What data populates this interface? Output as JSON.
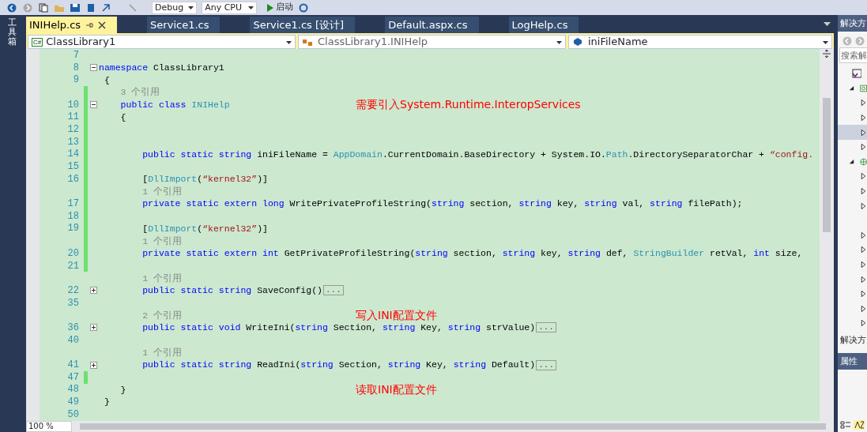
{
  "toolbar": {
    "config": "Debug",
    "platform": "Any CPU",
    "start": "启动"
  },
  "toolbox_label": "工具箱",
  "tabs": [
    {
      "label": "INIHelp.cs",
      "selected": true
    },
    {
      "label": "Service1.cs",
      "selected": false
    },
    {
      "label": "Service1.cs [设计]",
      "selected": false
    },
    {
      "label": "Default.aspx.cs",
      "selected": false
    },
    {
      "label": "LogHelp.cs",
      "selected": false
    }
  ],
  "nav": {
    "project_icon": "C#",
    "project": "ClassLibrary1",
    "type": "ClassLibrary1.INIHelp",
    "member": "iniFileName"
  },
  "lines": [
    {
      "kind": "code",
      "number": "7"
    },
    {
      "kind": "code",
      "number": "8",
      "folded": false,
      "tokens": [
        {
          "t": "namespace",
          "kind": "kw"
        },
        {
          "t": " ClassLibrary1",
          "kind": "plain"
        }
      ]
    },
    {
      "kind": "code",
      "number": "9",
      "tokens": [
        {
          "t": " {",
          "kind": "plain"
        }
      ]
    },
    {
      "kind": "lens",
      "changed": true,
      "text": "    3 个引用"
    },
    {
      "kind": "code",
      "number": "10",
      "changed": true,
      "folded": false,
      "note": "需要引入System.Runtime.InteropServices",
      "tokens": [
        {
          "t": "    public class",
          "kind": "kw"
        },
        {
          "t": " INIHelp",
          "kind": "type"
        }
      ]
    },
    {
      "kind": "code",
      "number": "11",
      "changed": true,
      "tokens": [
        {
          "t": "    {",
          "kind": "plain"
        }
      ]
    },
    {
      "kind": "code",
      "number": "12",
      "changed": true
    },
    {
      "kind": "code",
      "number": "13",
      "changed": true
    },
    {
      "kind": "code",
      "number": "14",
      "changed": true,
      "tokens": [
        {
          "t": "        public static string",
          "kind": "kw"
        },
        {
          "t": " iniFileName = ",
          "kind": "plain"
        },
        {
          "t": "AppDomain",
          "kind": "type"
        },
        {
          "t": ".CurrentDomain.BaseDirectory + System.IO.",
          "kind": "plain"
        },
        {
          "t": "Path",
          "kind": "type"
        },
        {
          "t": ".DirectorySeparatorChar + ",
          "kind": "plain"
        },
        {
          "t": "“config.",
          "kind": "str"
        }
      ]
    },
    {
      "kind": "code",
      "number": "15",
      "changed": true
    },
    {
      "kind": "code",
      "number": "16",
      "changed": true,
      "tokens": [
        {
          "t": "        [",
          "kind": "plain"
        },
        {
          "t": "DllImport",
          "kind": "type"
        },
        {
          "t": "(",
          "kind": "plain"
        },
        {
          "t": "“kernel32”",
          "kind": "str"
        },
        {
          "t": ")]",
          "kind": "plain"
        }
      ]
    },
    {
      "kind": "lens",
      "changed": true,
      "text": "        1 个引用"
    },
    {
      "kind": "code",
      "number": "17",
      "changed": true,
      "tokens": [
        {
          "t": "        private static extern long",
          "kind": "kw"
        },
        {
          "t": " WritePrivateProfileString(",
          "kind": "plain"
        },
        {
          "t": "string",
          "kind": "kw"
        },
        {
          "t": " section, ",
          "kind": "plain"
        },
        {
          "t": "string",
          "kind": "kw"
        },
        {
          "t": " key, ",
          "kind": "plain"
        },
        {
          "t": "string",
          "kind": "kw"
        },
        {
          "t": " val, ",
          "kind": "plain"
        },
        {
          "t": "string",
          "kind": "kw"
        },
        {
          "t": " filePath);",
          "kind": "plain"
        }
      ]
    },
    {
      "kind": "code",
      "number": "18",
      "changed": true
    },
    {
      "kind": "code",
      "number": "19",
      "changed": true,
      "tokens": [
        {
          "t": "        [",
          "kind": "plain"
        },
        {
          "t": "DllImport",
          "kind": "type"
        },
        {
          "t": "(",
          "kind": "plain"
        },
        {
          "t": "“kernel32”",
          "kind": "str"
        },
        {
          "t": ")]",
          "kind": "plain"
        }
      ]
    },
    {
      "kind": "lens",
      "changed": true,
      "text": "        1 个引用"
    },
    {
      "kind": "code",
      "number": "20",
      "changed": true,
      "tokens": [
        {
          "t": "        private static extern int",
          "kind": "kw"
        },
        {
          "t": " GetPrivateProfileString(",
          "kind": "plain"
        },
        {
          "t": "string",
          "kind": "kw"
        },
        {
          "t": " section, ",
          "kind": "plain"
        },
        {
          "t": "string",
          "kind": "kw"
        },
        {
          "t": " key, ",
          "kind": "plain"
        },
        {
          "t": "string",
          "kind": "kw"
        },
        {
          "t": " def, ",
          "kind": "plain"
        },
        {
          "t": "StringBuilder",
          "kind": "type"
        },
        {
          "t": " retVal, ",
          "kind": "plain"
        },
        {
          "t": "int",
          "kind": "kw"
        },
        {
          "t": " size,",
          "kind": "plain"
        }
      ]
    },
    {
      "kind": "code",
      "number": "21",
      "changed": true
    },
    {
      "kind": "lens",
      "text": "        1 个引用"
    },
    {
      "kind": "code",
      "number": "22",
      "folded": true,
      "collapsed": "...",
      "tokens": [
        {
          "t": "        public static string",
          "kind": "kw"
        },
        {
          "t": " SaveConfig()",
          "kind": "plain"
        }
      ]
    },
    {
      "kind": "code",
      "number": "35"
    },
    {
      "kind": "lens",
      "text": "        2 个引用",
      "note": "写入INI配置文件"
    },
    {
      "kind": "code",
      "number": "36",
      "folded": true,
      "collapsed": "...",
      "tokens": [
        {
          "t": "        public static void",
          "kind": "kw"
        },
        {
          "t": " WriteIni(",
          "kind": "plain"
        },
        {
          "t": "string",
          "kind": "kw"
        },
        {
          "t": " Section, ",
          "kind": "plain"
        },
        {
          "t": "string",
          "kind": "kw"
        },
        {
          "t": " Key, ",
          "kind": "plain"
        },
        {
          "t": "string",
          "kind": "kw"
        },
        {
          "t": " strValue)",
          "kind": "plain"
        }
      ]
    },
    {
      "kind": "code",
      "number": "40"
    },
    {
      "kind": "lens",
      "text": "        1 个引用"
    },
    {
      "kind": "code",
      "number": "41",
      "folded": true,
      "collapsed": "...",
      "tokens": [
        {
          "t": "        public static string",
          "kind": "kw"
        },
        {
          "t": " ReadIni(",
          "kind": "plain"
        },
        {
          "t": "string",
          "kind": "kw"
        },
        {
          "t": " Section, ",
          "kind": "plain"
        },
        {
          "t": "string",
          "kind": "kw"
        },
        {
          "t": " Key, ",
          "kind": "plain"
        },
        {
          "t": "string",
          "kind": "kw"
        },
        {
          "t": " Default)",
          "kind": "plain"
        }
      ]
    },
    {
      "kind": "code",
      "number": "47",
      "changed": true
    },
    {
      "kind": "code",
      "number": "48",
      "note": "读取INI配置文件",
      "tokens": [
        {
          "t": "    }",
          "kind": "plain"
        }
      ]
    },
    {
      "kind": "code",
      "number": "49",
      "tokens": [
        {
          "t": " }",
          "kind": "plain"
        }
      ]
    },
    {
      "kind": "code",
      "number": "50"
    }
  ],
  "zoom": "100 %",
  "solution_explorer": {
    "title": "解决方",
    "search_placeholder": "搜索解",
    "tree": [
      {
        "kind": "solution",
        "selected": false
      },
      {
        "kind": "project",
        "expanded": true,
        "selected": false,
        "children": [
          {
            "kind": "node",
            "selected": false
          },
          {
            "kind": "node",
            "selected": false
          },
          {
            "kind": "node",
            "selected": true
          },
          {
            "kind": "node",
            "selected": false
          }
        ]
      },
      {
        "kind": "web",
        "expanded": true,
        "selected": false,
        "children": [
          {
            "kind": "node",
            "selected": false
          },
          {
            "kind": "node",
            "selected": false
          },
          {
            "kind": "node",
            "selected": false
          },
          {
            "kind": "blank"
          },
          {
            "kind": "node",
            "selected": false
          },
          {
            "kind": "node",
            "selected": false
          },
          {
            "kind": "node",
            "selected": false
          },
          {
            "kind": "node",
            "selected": false
          },
          {
            "kind": "node",
            "selected": false
          },
          {
            "kind": "node",
            "selected": false
          },
          {
            "kind": "node",
            "selected": false
          }
        ]
      }
    ],
    "bottom_tab": "解决方"
  },
  "properties": {
    "title": "属性"
  }
}
